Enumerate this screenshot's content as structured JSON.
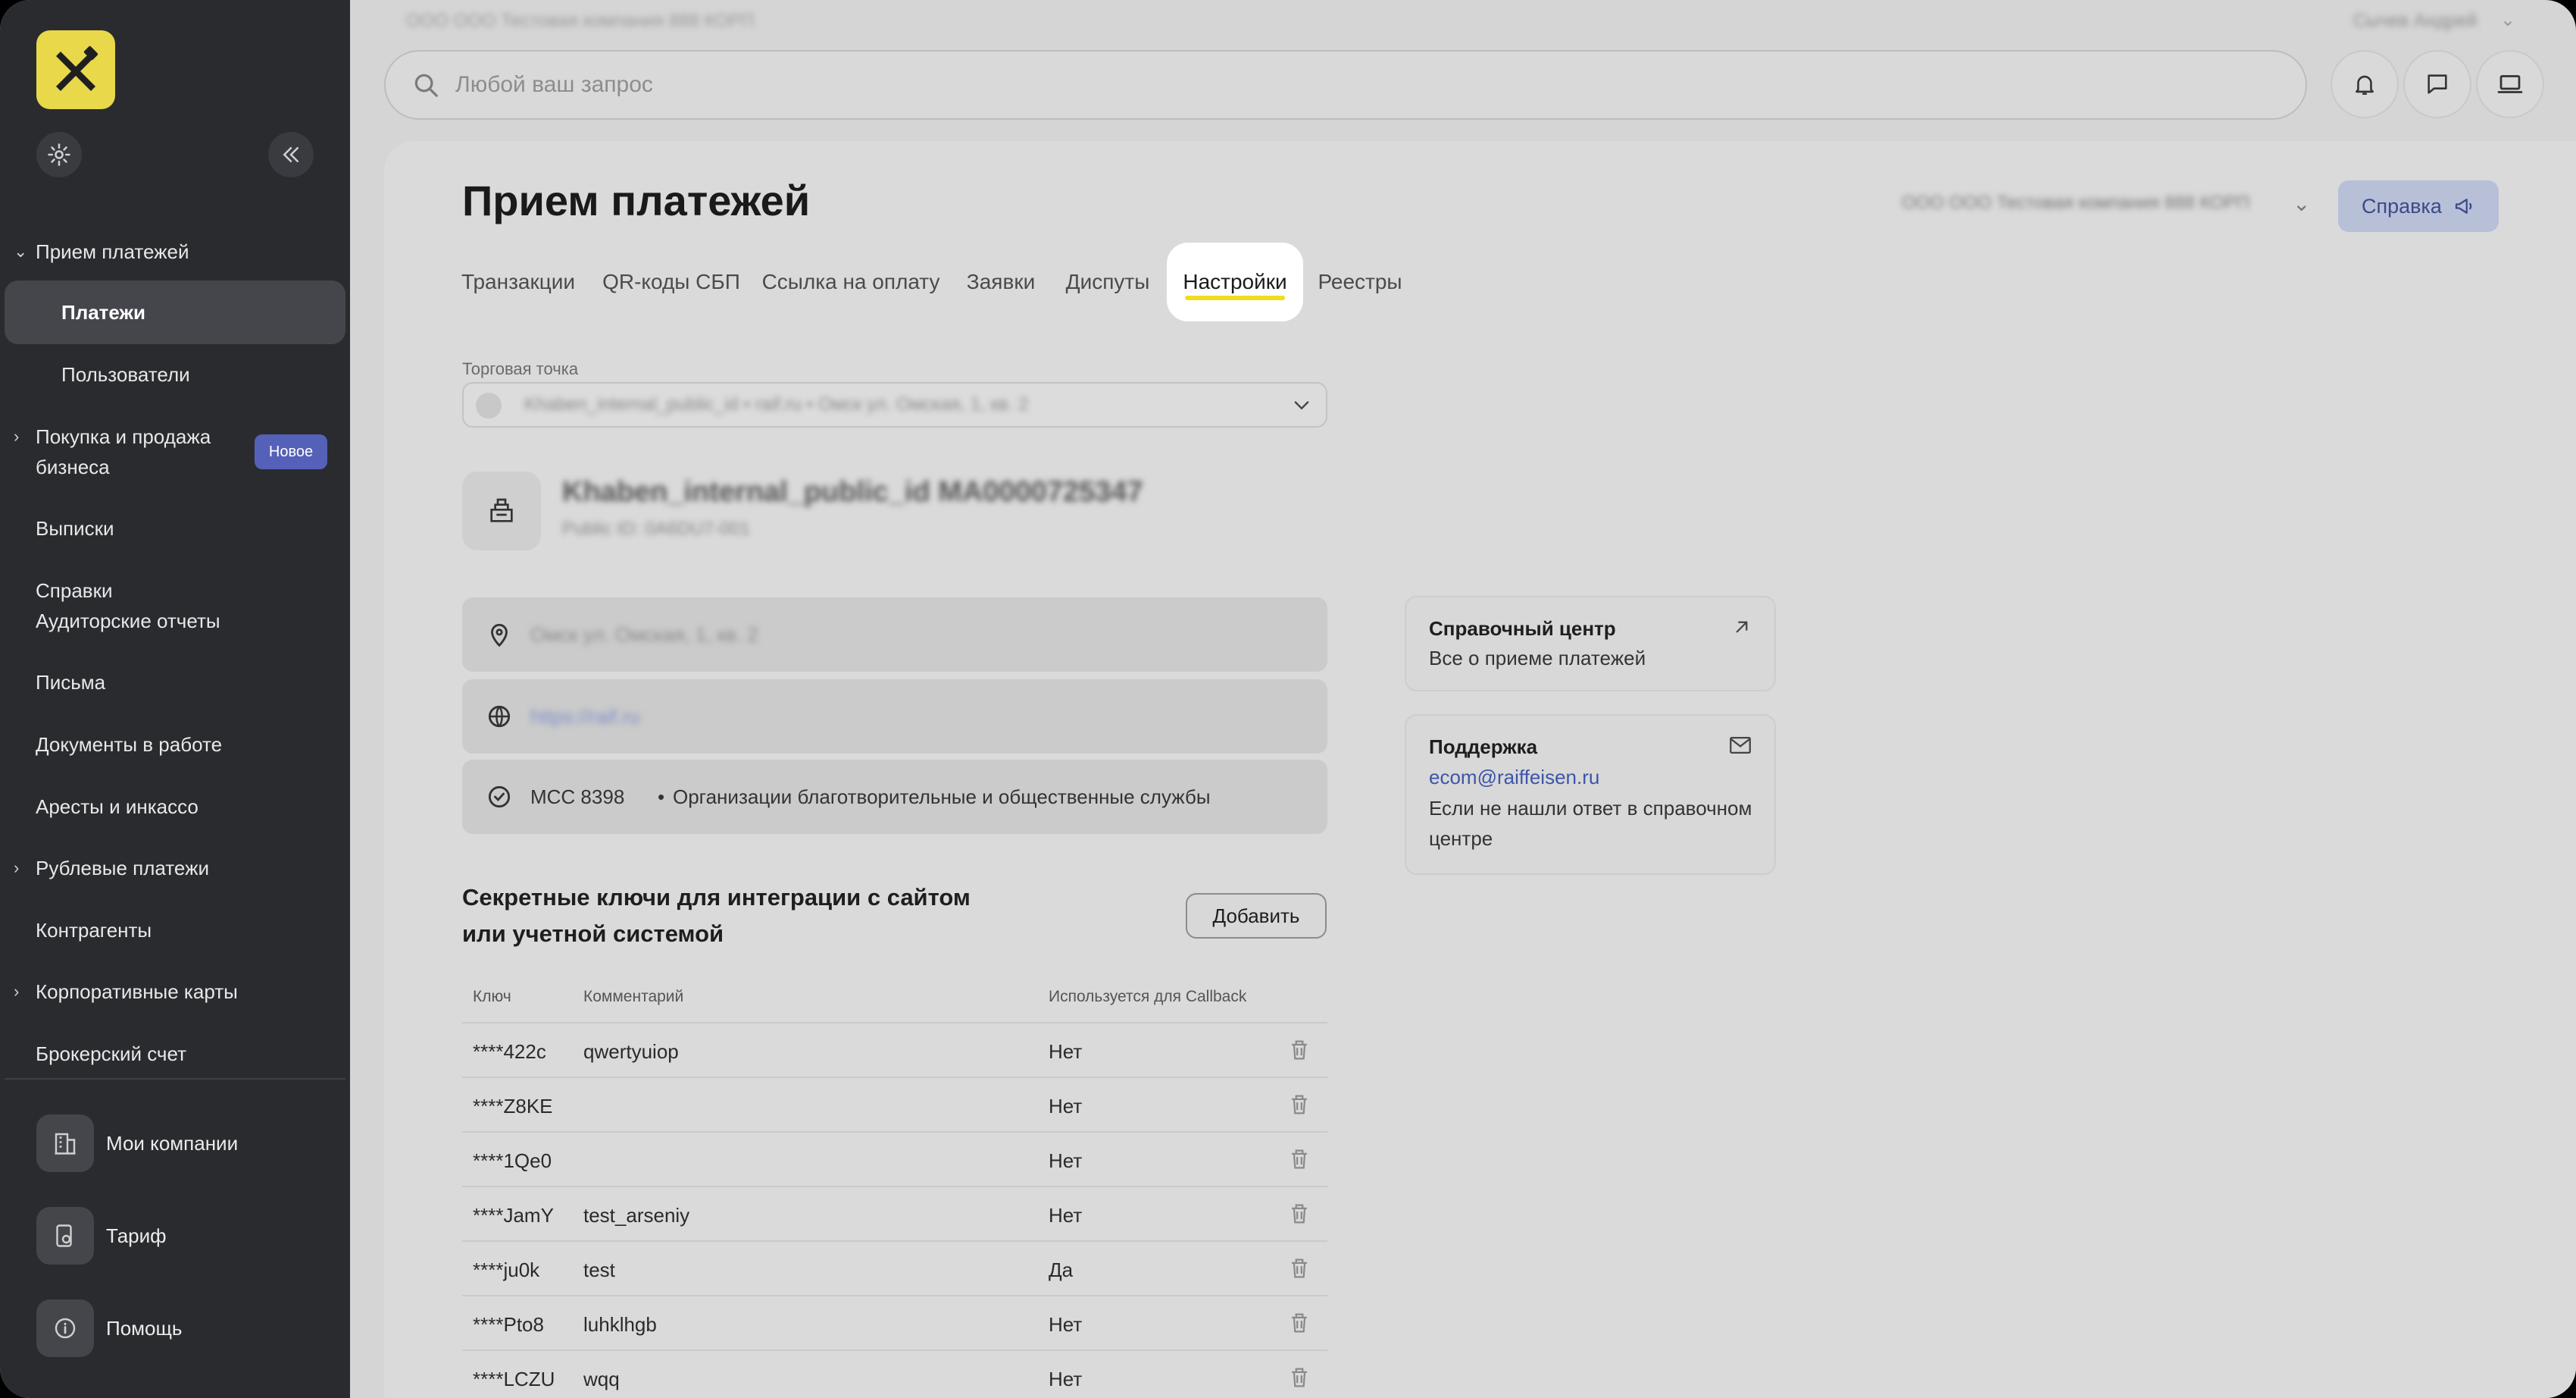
{
  "top": {
    "company": "ООО ООО Тестовая компания 888 КОРП",
    "user": "Сычев Андрей",
    "search_placeholder": "Любой ваш запрос"
  },
  "sidebar": {
    "sections": {
      "payments": "Прием платежей",
      "payments_sub_active": "Платежи",
      "payments_sub_users": "Пользователи",
      "business_line1": "Покупка и продажа",
      "business_line2": "бизнеса",
      "business_badge": "Новое",
      "statements": "Выписки",
      "references": "Справки",
      "audit": "Аудиторские отчеты",
      "letters": "Письма",
      "docs": "Документы в работе",
      "arrests": "Аресты и инкассо",
      "ruble": "Рублевые платежи",
      "contractors": "Контрагенты",
      "cards": "Корпоративные карты",
      "broker": "Брокерский счет"
    },
    "bottom": {
      "companies": "Мои компании",
      "tariff": "Тариф",
      "help": "Помощь"
    }
  },
  "page": {
    "title": "Прием платежей",
    "company_select": "ООО ООО Тестовая компания 888 КОРП",
    "help_button": "Справка",
    "tabs": [
      "Транзакции",
      "QR-коды СБП",
      "Ссылка на оплату",
      "Заявки",
      "Диспуты",
      "Настройки",
      "Реестры"
    ],
    "active_tab": "Настройки"
  },
  "settings": {
    "point_label": "Торговая точка",
    "point_value": "Khaben_internal_public_id • raif.ru • Омск ул. Омская, 1, кв. 2",
    "shop_name": "Khaben_internal_public_id MA0000725347",
    "shop_public_id": "Public ID: 0A6DU7-001",
    "address": "Омск ул. Омская, 1, кв. 2",
    "site": "https://raif.ru",
    "mcc": "MCC 8398",
    "mcc_desc": "Организации благотворительные и общественные службы"
  },
  "help_center": {
    "title": "Справочный центр",
    "text": "Все о приеме платежей"
  },
  "support": {
    "title": "Поддержка",
    "email": "ecom@raiffeisen.ru",
    "text": "Если не нашли ответ в справочном центре"
  },
  "keys": {
    "title": "Секретные ключи для интеграции с сайтом или учетной системой",
    "add_button": "Добавить",
    "columns": [
      "Ключ",
      "Комментарий",
      "Используется для Callback"
    ],
    "rows": [
      {
        "key": "****422c",
        "comment": "qwertyuiop",
        "callback": "Нет"
      },
      {
        "key": "****Z8KE",
        "comment": "",
        "callback": "Нет"
      },
      {
        "key": "****1Qe0",
        "comment": "",
        "callback": "Нет"
      },
      {
        "key": "****JamY",
        "comment": "test_arseniy",
        "callback": "Нет"
      },
      {
        "key": "****ju0k",
        "comment": "test",
        "callback": "Да"
      },
      {
        "key": "****Pto8",
        "comment": "luhklhgb",
        "callback": "Нет"
      },
      {
        "key": "****LCZU",
        "comment": "wqq",
        "callback": "Нет"
      }
    ]
  },
  "colors": {
    "sidebar_bg": "#2a2b2f",
    "accent_yellow": "#f1dc1f",
    "badge_blue": "#5561b8",
    "link_blue": "#3d55a8"
  }
}
